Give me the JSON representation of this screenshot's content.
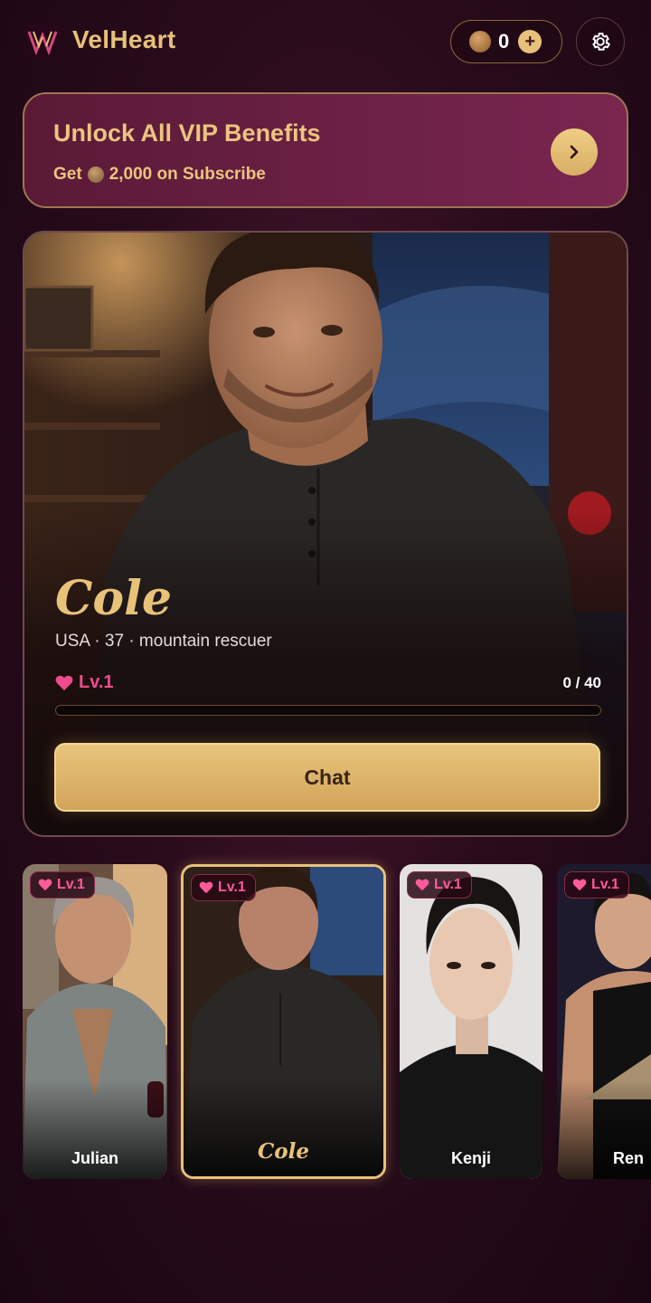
{
  "header": {
    "app_name": "VelHeart",
    "coins": "0",
    "logo_icon": "velheart-logo",
    "settings_icon": "gear-icon"
  },
  "vip": {
    "title": "Unlock All VIP Benefits",
    "subtitle_prefix": "Get",
    "subtitle_amount": "2,000 on Subscribe"
  },
  "featured": {
    "name": "Cole",
    "meta": "USA · 37 · mountain rescuer",
    "level": "Lv.1",
    "progress_text": "0 / 40",
    "progress": 0,
    "chat_label": "Chat"
  },
  "characters": [
    {
      "name": "Julian",
      "level": "Lv.1"
    },
    {
      "name": "Cole",
      "level": "Lv.1",
      "selected": true
    },
    {
      "name": "Kenji",
      "level": "Lv.1"
    },
    {
      "name": "Ren",
      "level": "Lv.1"
    }
  ],
  "colors": {
    "accent_gold": "#e7c07a",
    "heart_pink": "#f04a8c",
    "background": "#2a0c1c"
  }
}
